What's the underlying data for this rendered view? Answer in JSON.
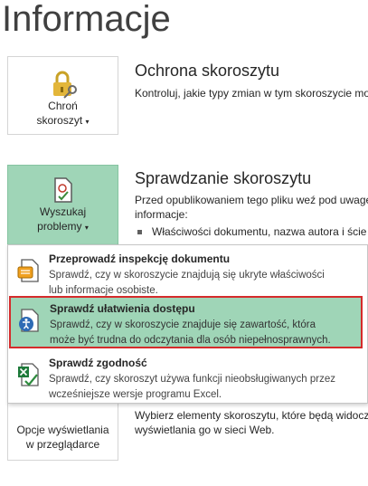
{
  "page": {
    "title": "Informacje"
  },
  "protect": {
    "button": {
      "line1": "Chroń",
      "line2": "skoroszyt",
      "icon": "lock-key-icon"
    },
    "title": "Ochrona skoroszytu",
    "desc": "Kontroluj, jakie typy zmian w tym skoroszycie mo"
  },
  "check": {
    "button": {
      "line1": "Wyszukaj",
      "line2": "problemy",
      "icon": "document-check-icon"
    },
    "title": "Sprawdzanie skoroszytu",
    "desc1": "Przed opublikowaniem tego pliku weź pod uwagę",
    "desc2": "informacje:",
    "bullet": "Właściwości dokumentu, nazwa autora i ście"
  },
  "browser": {
    "button": {
      "line1": "Opcje wyświetlania",
      "line2": "w przeglądarce"
    },
    "desc1": "Wybierz elementy skoroszytu, które będą widoczn",
    "desc2": "wyświetlania go w sieci Web."
  },
  "menu": {
    "items": [
      {
        "title": "Przeprowadź inspekcję dokumentu",
        "desc1": "Sprawdź, czy w skoroszycie znajdują się ukryte właściwości",
        "desc2": "lub informacje osobiste.",
        "icon": "inspect-document-icon"
      },
      {
        "title": "Sprawdź ułatwienia dostępu",
        "desc1": "Sprawdź, czy w skoroszycie znajduje się zawartość, która",
        "desc2": "może być trudna do odczytania dla osób niepełnosprawnych.",
        "icon": "accessibility-icon"
      },
      {
        "title": "Sprawdź zgodność",
        "desc1": "Sprawdź, czy skoroszyt używa funkcji nieobsługiwanych przez",
        "desc2": "wcześniejsze wersje programu Excel.",
        "icon": "compatibility-icon"
      }
    ]
  },
  "colors": {
    "highlight": "#9fd5b7",
    "focus_border": "#d52b2b"
  }
}
